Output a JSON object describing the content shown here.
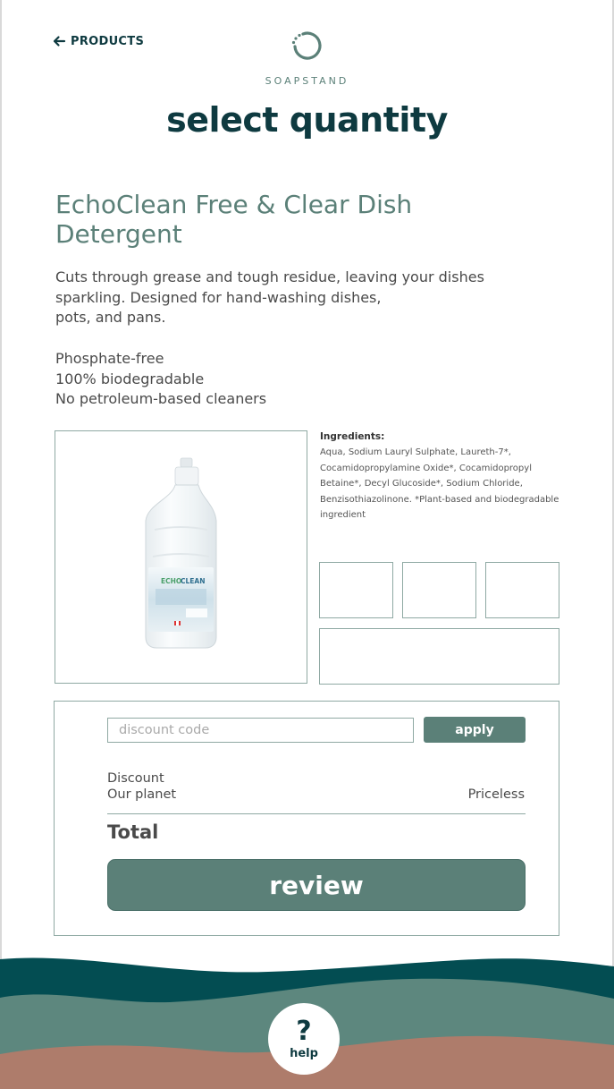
{
  "header": {
    "back_label": "PRODUCTS",
    "brand_name": "SOAPSTAND",
    "page_title": "select quantity"
  },
  "product": {
    "name": "EchoClean Free & Clear Dish Detergent",
    "description": "Cuts through grease and tough residue, leaving your dishes\nsparkling. Designed for hand-washing dishes,\npots, and pans.",
    "features": [
      "Phosphate-free",
      "100% biodegradable",
      "No petroleum-based cleaners"
    ],
    "ingredients_title": "Ingredients:",
    "ingredients_text": "Aqua, Sodium Lauryl Sulphate, Laureth-7*, Cocamidopropylamine Oxide*, Cocamidopropyl Betaine*, Decyl Glucoside*, Sodium Chloride, Benzisothiazolinone. *Plant-based and biodegradable ingredient",
    "image_label": "ECHOCLEAN"
  },
  "checkout": {
    "discount_placeholder": "discount code",
    "apply_label": "apply",
    "discount_label": "Discount",
    "planet_label": "Our planet",
    "planet_value": "Priceless",
    "total_label": "Total",
    "review_label": "review"
  },
  "help": {
    "icon": "?",
    "label": "help"
  },
  "colors": {
    "dark_teal": "#0e3a40",
    "sage": "#5b8078",
    "wave_dark": "#034d52",
    "wave_mid": "#5d877e",
    "wave_clay": "#ae7c6b"
  }
}
